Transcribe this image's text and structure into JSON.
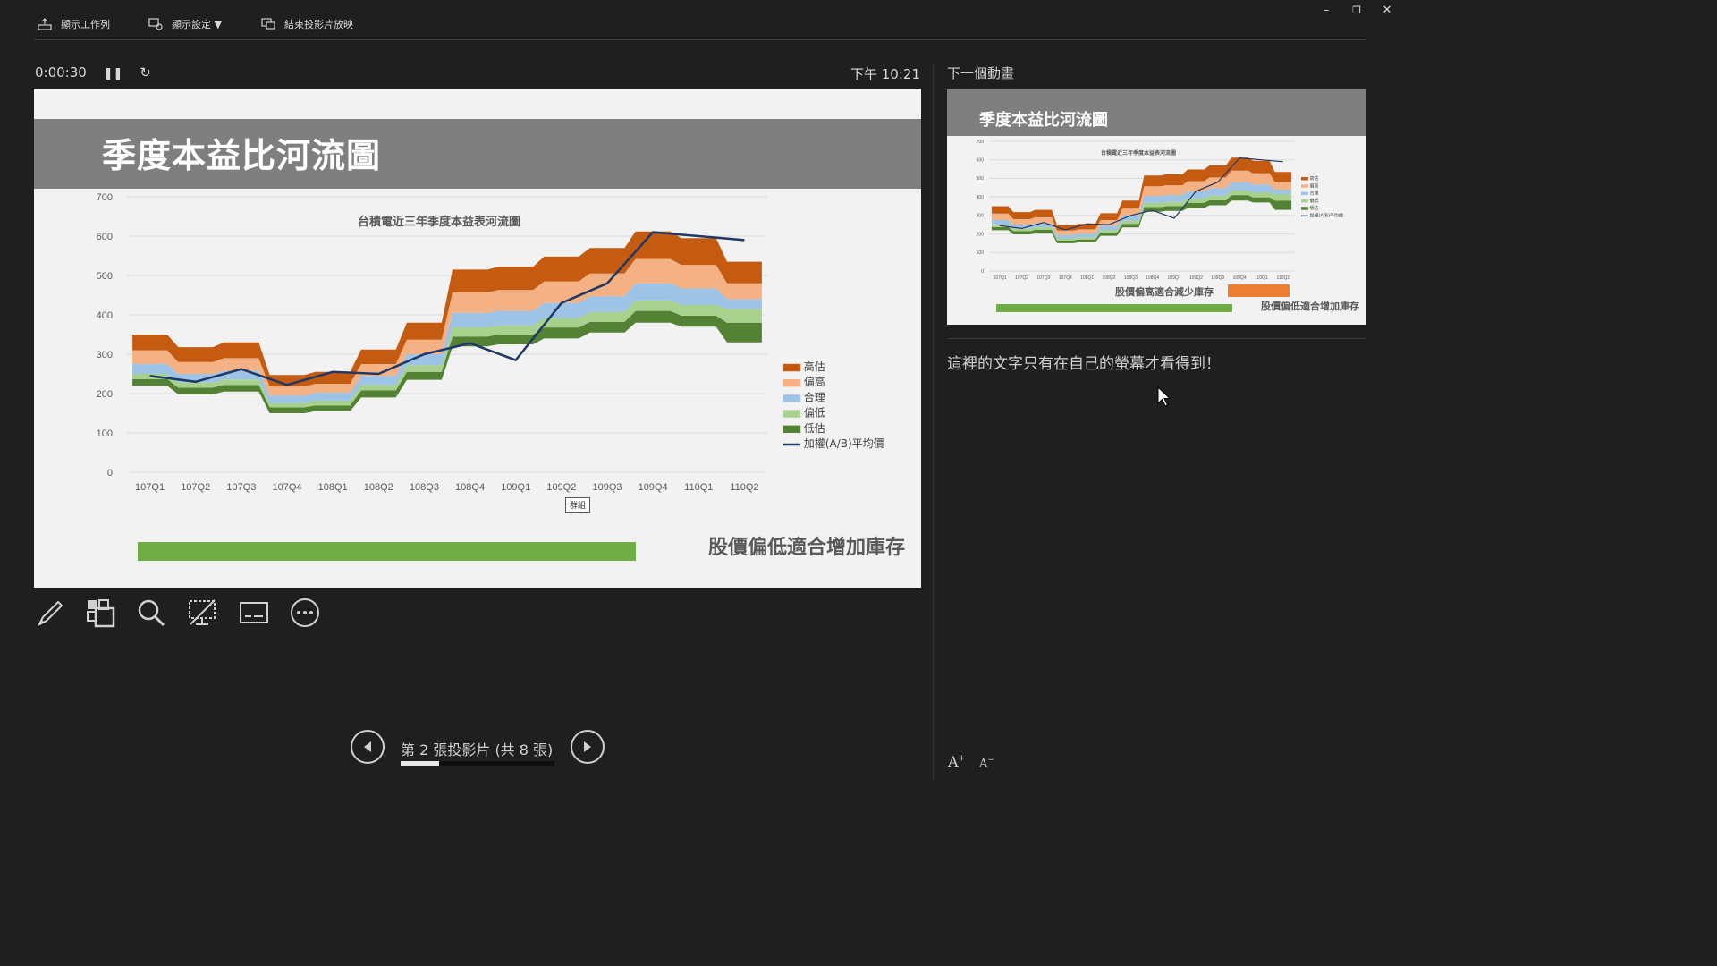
{
  "toolbar": {
    "show_taskbar": "顯示工作列",
    "display_settings": "顯示設定 ▼",
    "end_show": "結束投影片放映"
  },
  "window": {
    "minimize": "–",
    "restore": "❐",
    "close": "✕"
  },
  "presenter": {
    "elapsed": "0:00:30",
    "clock": "下午 10:21",
    "next_label": "下一個動畫",
    "notes": "這裡的文字只有在自己的螢幕才看得到！",
    "slide_counter": "第 2 張投影片 (共 8 張)",
    "progress_fraction": 0.25,
    "font_increase": "A",
    "font_decrease": "A"
  },
  "slide": {
    "title": "季度本益比河流圖",
    "caption": "股價偏低適合增加庫存",
    "group_tag": "群組"
  },
  "next_slide": {
    "title": "季度本益比河流圖",
    "caption_high": "股價偏高適合減少庫存",
    "caption_low": "股價偏低適合增加庫存"
  },
  "colors": {
    "high": "#c55a11",
    "upper": "#f4b183",
    "fair": "#9dc3e6",
    "lower": "#a9d18e",
    "low": "#548235",
    "avg_line": "#203864",
    "title_band": "#7f7f7f",
    "green_bar": "#70ad47",
    "orange_bar": "#ed7d31"
  },
  "chart_data": {
    "type": "area",
    "title": "台積電近三年季度本益表河流圖",
    "xlabel": "",
    "ylabel": "",
    "ylim": [
      0,
      700
    ],
    "yticks": [
      0,
      100,
      200,
      300,
      400,
      500,
      600,
      700
    ],
    "categories": [
      "107Q1",
      "107Q2",
      "107Q3",
      "107Q4",
      "108Q1",
      "108Q2",
      "108Q3",
      "108Q4",
      "109Q1",
      "109Q2",
      "109Q3",
      "109Q4",
      "110Q1",
      "110Q2"
    ],
    "stack_bounds": [
      [
        220,
        237,
        250,
        275,
        310,
        350,
        405
      ],
      [
        198,
        215,
        228,
        250,
        280,
        318,
        365
      ],
      [
        205,
        222,
        236,
        258,
        290,
        330,
        380
      ],
      [
        150,
        165,
        176,
        195,
        218,
        247,
        275
      ],
      [
        155,
        170,
        182,
        202,
        225,
        255,
        290
      ],
      [
        190,
        208,
        222,
        245,
        275,
        312,
        345
      ],
      [
        235,
        255,
        272,
        300,
        337,
        380,
        390
      ],
      [
        320,
        345,
        368,
        405,
        457,
        515,
        530
      ],
      [
        325,
        350,
        373,
        410,
        463,
        522,
        540
      ],
      [
        340,
        368,
        392,
        430,
        485,
        548,
        565
      ],
      [
        355,
        382,
        407,
        447,
        505,
        570,
        588
      ],
      [
        380,
        410,
        437,
        480,
        542,
        612,
        630
      ],
      [
        370,
        398,
        425,
        467,
        527,
        595,
        620
      ],
      [
        330,
        380,
        415,
        440,
        480,
        535,
        620
      ]
    ],
    "series": [
      {
        "name": "高估"
      },
      {
        "name": "偏高"
      },
      {
        "name": "合理"
      },
      {
        "name": "偏低"
      },
      {
        "name": "低估"
      },
      {
        "name": "加權(A/B)平均價",
        "values": [
          245,
          230,
          262,
          222,
          255,
          250,
          300,
          328,
          285,
          430,
          480,
          610,
          600,
          590
        ]
      }
    ],
    "legend_position": "right",
    "grid": true
  }
}
